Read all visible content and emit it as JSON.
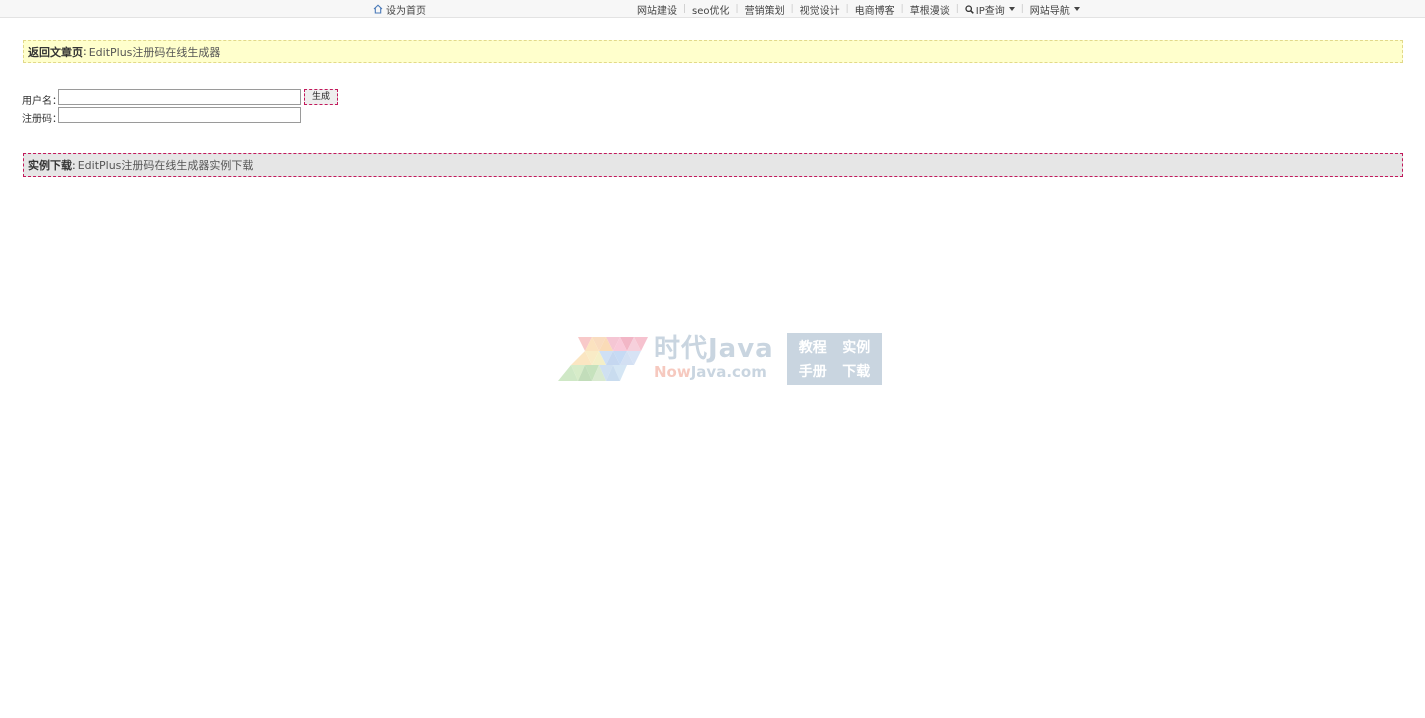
{
  "topbar": {
    "home_label": "设为首页",
    "nav": [
      "网站建设",
      "seo优化",
      "营销策划",
      "视觉设计",
      "电商博客",
      "草根漫谈",
      "IP查询",
      "网站导航"
    ]
  },
  "backbar": {
    "label": "返回文章页",
    "link": "EditPlus注册码在线生成器"
  },
  "form": {
    "username_label": "用户名：",
    "username_value": "",
    "regcode_label": "注册码：",
    "regcode_value": "",
    "generate_label": "生成"
  },
  "download": {
    "label": "实例下载",
    "link": "EditPlus注册码在线生成器实例下载"
  },
  "watermark": {
    "title": "时代Java",
    "domain_now": "Now",
    "domain_rest": "Java.com",
    "box": [
      "教程",
      "实例",
      "手册",
      "下载"
    ]
  },
  "colors": {
    "backbar_bg": "#ffffcc",
    "dlbar_bg": "#e6e6e6",
    "dashed_accent": "#c2185b",
    "watermark": "#c9d5e0"
  }
}
